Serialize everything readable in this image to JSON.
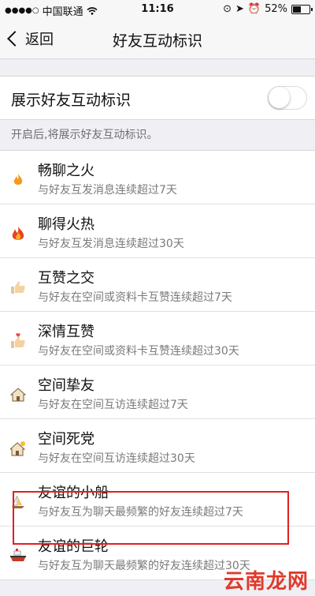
{
  "status_bar": {
    "signal_dots": "●●●●○",
    "carrier": "中国联通",
    "time": "11:16",
    "battery_text": "52%",
    "battery_level": 0.52
  },
  "nav": {
    "back_label": "返回",
    "title": "好友互动标识"
  },
  "toggle": {
    "label": "展示好友互动标识",
    "on": false
  },
  "hint": "开启后,将展示好友互动标识。",
  "items": [
    {
      "title": "畅聊之火",
      "desc": "与好友互发消息连续超过7天",
      "icon": "flame-icon"
    },
    {
      "title": "聊得火热",
      "desc": "与好友互发消息连续超过30天",
      "icon": "big-flame-icon"
    },
    {
      "title": "互赞之交",
      "desc": "与好友在空间或资料卡互赞连续超过7天",
      "icon": "thumbs-up-icon"
    },
    {
      "title": "深情互赞",
      "desc": "与好友在空间或资料卡互赞连续超过30天",
      "icon": "thumbs-up-heart-icon"
    },
    {
      "title": "空间挚友",
      "desc": "与好友在空间互访连续超过7天",
      "icon": "house-icon"
    },
    {
      "title": "空间死党",
      "desc": "与好友在空间互访连续超过30天",
      "icon": "house-sun-icon"
    },
    {
      "title": "友谊的小船",
      "desc": "与好友互为聊天最频繁的好友连续超过7天",
      "icon": "sailboat-icon"
    },
    {
      "title": "友谊的巨轮",
      "desc": "与好友互为聊天最频繁的好友连续超过30天",
      "icon": "ship-icon"
    }
  ],
  "watermark": "云南龙网",
  "colors": {
    "highlight": "#e02020",
    "flame": "#f39a1e",
    "watermark": "#e03a2a"
  }
}
